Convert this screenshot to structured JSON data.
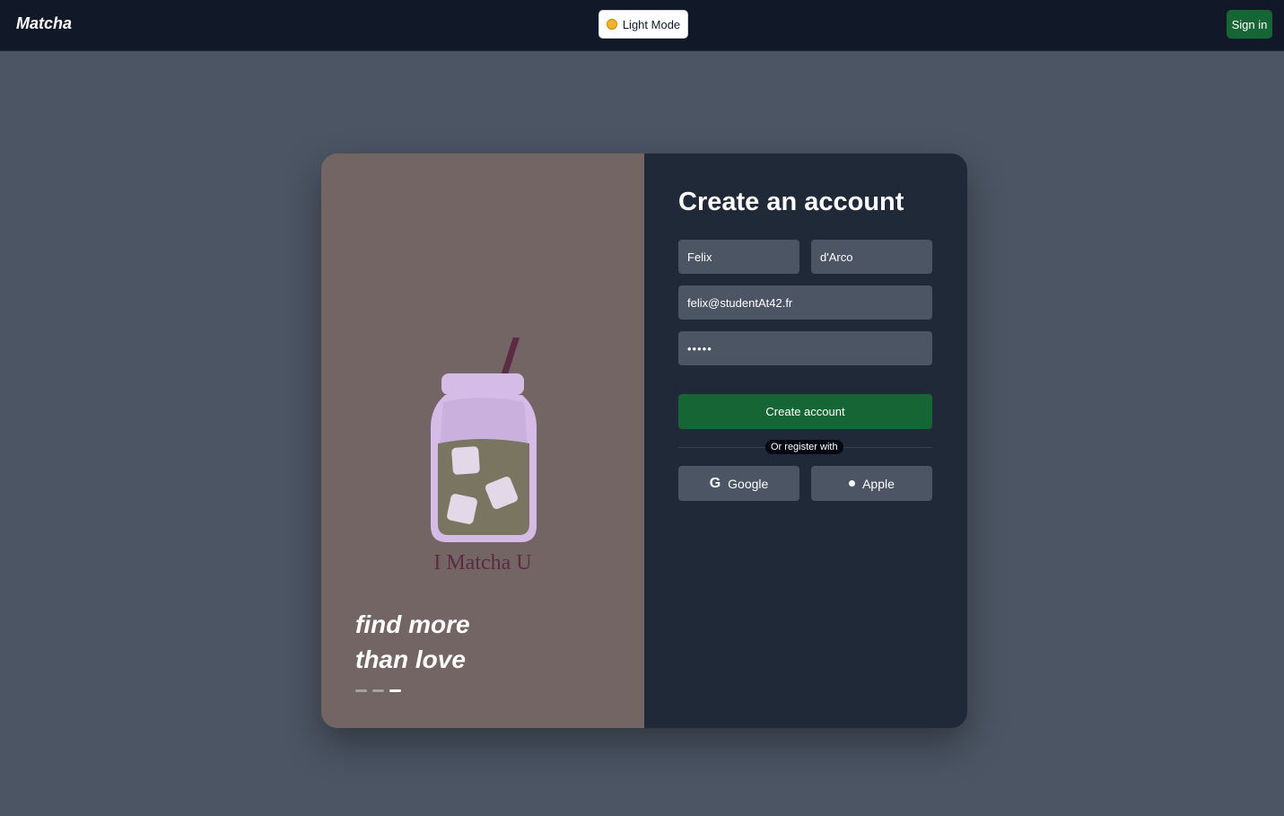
{
  "navbar": {
    "brand": "Matcha",
    "mode_toggle": "Light Mode",
    "sign_in": "Sign in"
  },
  "left_panel": {
    "illustration_caption": "I Matcha U",
    "slogan_line1": "find more",
    "slogan_line2": "than love",
    "carousel_total": 3,
    "carousel_active_index": 3
  },
  "form": {
    "title": "Create an account",
    "first_name": "Felix",
    "last_name": "d'Arco",
    "email": "felix@studentAt42.fr",
    "password": "•••••",
    "submit_label": "Create account",
    "divider_text": "Or register with",
    "google_label": "Google",
    "apple_label": "Apple"
  },
  "colors": {
    "page_bg": "#4b5563",
    "navbar_bg": "#111827",
    "left_panel_bg": "#736563",
    "right_panel_bg": "#1f2937",
    "accent_green": "#166534",
    "field_bg": "#4b5563"
  },
  "icons": {
    "mode_icon": "sun-icon",
    "google_icon": "google-icon",
    "apple_icon": "apple-icon"
  }
}
